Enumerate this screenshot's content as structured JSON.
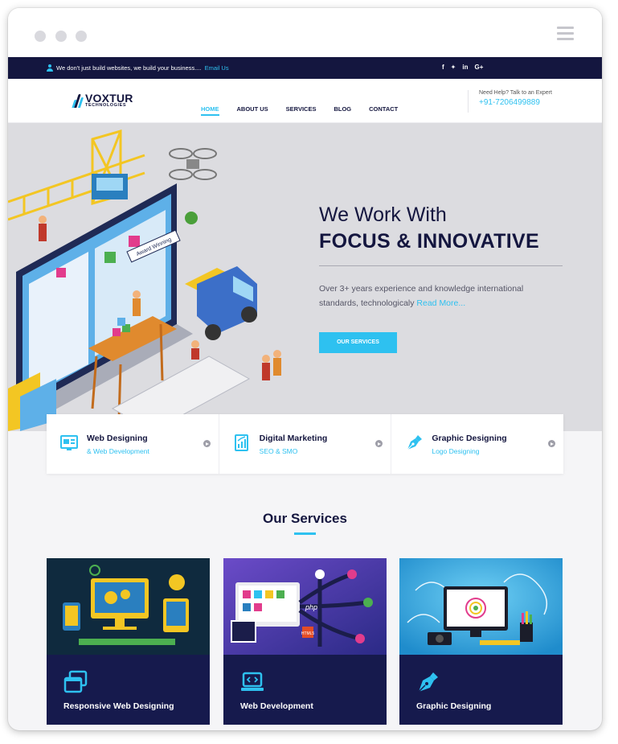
{
  "topbar": {
    "message": "We don't just build websites, we build your business....",
    "email_label": "Email Us",
    "social": [
      {
        "icon": "facebook-icon",
        "glyph": "f"
      },
      {
        "icon": "twitter-icon",
        "glyph": "✦"
      },
      {
        "icon": "linkedin-icon",
        "glyph": "in"
      },
      {
        "icon": "google-plus-icon",
        "glyph": "G+"
      }
    ]
  },
  "header": {
    "logo_name": "VOXTUR",
    "logo_sub": "TECHNOLOGIES",
    "nav": [
      "HOME",
      "ABOUT US",
      "SERVICES",
      "BLOG",
      "CONTACT"
    ],
    "active_nav": "HOME",
    "help_label": "Need Help? Talk to an Expert",
    "help_phone": "+91-7206499889"
  },
  "hero": {
    "line1": "We Work With",
    "line2": "FOCUS & INNOVATIVE",
    "description": "Over 3+ years experience and knowledge international standards, technologicaly",
    "read_more": "Read More...",
    "button_label": "OUR SERVICES",
    "illustration_sign": "Award Winning"
  },
  "features": [
    {
      "title": "Web Designing",
      "subtitle": "& Web Development",
      "icon": "web-layout-icon"
    },
    {
      "title": "Digital Marketing",
      "subtitle": "SEO & SMO",
      "icon": "marketing-chart-icon"
    },
    {
      "title": "Graphic Designing",
      "subtitle": "Logo Designing",
      "icon": "pen-nib-icon"
    }
  ],
  "services": {
    "title": "Our Services",
    "items": [
      {
        "label": "Responsive Web Designing",
        "icon": "responsive-windows-icon"
      },
      {
        "label": "Web Development",
        "icon": "code-laptop-icon"
      },
      {
        "label": "Graphic Designing",
        "icon": "pen-nib-icon"
      }
    ],
    "image_texts": [
      "php",
      "HTML5"
    ]
  },
  "colors": {
    "navy": "#14163f",
    "accent": "#2ec1f0",
    "hero_bg": "#dcdce0",
    "card_bg": "#161a4d"
  }
}
